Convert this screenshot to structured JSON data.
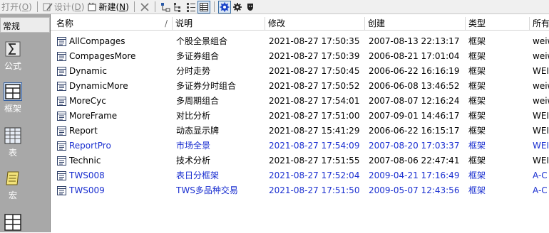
{
  "toolbar": {
    "open": "打开(",
    "open_key": "O",
    "design": "设计(",
    "design_key": "D",
    "new": "新建(",
    "new_key": "N",
    "close_paren": ")"
  },
  "sidebar": {
    "header": "常规",
    "items": [
      {
        "label": "公式",
        "icon": "formula-icon"
      },
      {
        "label": "框架",
        "icon": "frame-icon",
        "selected": true
      },
      {
        "label": "表",
        "icon": "table-icon"
      },
      {
        "label": "宏",
        "icon": "macro-icon"
      },
      {
        "label": "",
        "icon": "grid-icon"
      }
    ]
  },
  "table": {
    "columns": [
      "名称",
      "说明",
      "修改",
      "创建",
      "类型",
      "所有"
    ],
    "rows": [
      {
        "name": "AllCompages",
        "desc": "个股全景组合",
        "modified": "2021-08-27 17:50:35",
        "created": "2007-08-13 22:13:17",
        "type": "框架",
        "owner": "weiw",
        "highlight": false
      },
      {
        "name": "CompagesMore",
        "desc": "多证券组合",
        "modified": "2021-08-27 17:50:39",
        "created": "2006-08-21 17:01:04",
        "type": "框架",
        "owner": "weiw",
        "highlight": false
      },
      {
        "name": "Dynamic",
        "desc": "分时走势",
        "modified": "2021-08-27 17:50:45",
        "created": "2006-06-22 16:16:19",
        "type": "框架",
        "owner": "WEI",
        "highlight": false
      },
      {
        "name": "DynamicMore",
        "desc": "多证券分时组合",
        "modified": "2021-08-27 17:50:52",
        "created": "2006-06-08 13:46:52",
        "type": "框架",
        "owner": "weiw",
        "highlight": false
      },
      {
        "name": "MoreCyc",
        "desc": "多周期组合",
        "modified": "2021-08-27 17:54:01",
        "created": "2007-08-07 12:16:24",
        "type": "框架",
        "owner": "weiw",
        "highlight": false
      },
      {
        "name": "MoreFrame",
        "desc": "对比分析",
        "modified": "2021-08-27 17:51:00",
        "created": "2007-09-01 14:46:17",
        "type": "框架",
        "owner": "WEI",
        "highlight": false
      },
      {
        "name": "Report",
        "desc": "动态显示牌",
        "modified": "2021-08-27 15:41:29",
        "created": "2006-06-22 16:15:17",
        "type": "框架",
        "owner": "WEI",
        "highlight": false
      },
      {
        "name": "ReportPro",
        "desc": "市场全景",
        "modified": "2021-08-27 17:54:09",
        "created": "2007-08-20 17:03:37",
        "type": "框架",
        "owner": "WEI",
        "highlight": true
      },
      {
        "name": "Technic",
        "desc": "技术分析",
        "modified": "2021-08-27 17:51:55",
        "created": "2007-08-06 22:47:41",
        "type": "框架",
        "owner": "WEI",
        "highlight": false
      },
      {
        "name": "TWS008",
        "desc": "表日分框架",
        "modified": "2021-08-27 17:52:04",
        "created": "2009-04-21 17:16:49",
        "type": "框架",
        "owner": "A-C",
        "highlight": true
      },
      {
        "name": "TWS009",
        "desc": "TWS多品种交易",
        "modified": "2021-08-27 17:51:50",
        "created": "2009-05-07 12:43:56",
        "type": "框架",
        "owner": "A-C",
        "highlight": true
      }
    ]
  },
  "colors": {
    "highlight_text": "#1a2fd0",
    "sidebar_bg": "#a8a8a8"
  }
}
